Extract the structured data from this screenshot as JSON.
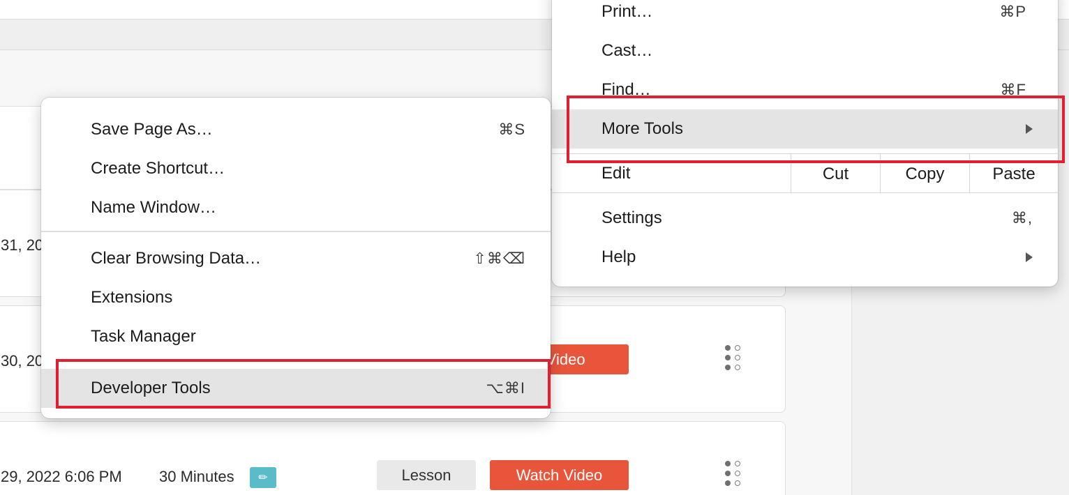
{
  "page": {
    "rows": [
      {
        "date": "31, 20",
        "duration": "",
        "lesson_label": "",
        "watch_label": ""
      },
      {
        "date": "30, 20",
        "duration": "",
        "lesson_label": "",
        "watch_label": "n Video"
      },
      {
        "date": "29, 2022 6:06 PM",
        "duration": "30 Minutes",
        "lesson_label": "Lesson",
        "watch_label": "Watch Video",
        "edit_icon": "pencil-icon"
      }
    ],
    "colors": {
      "watch_button": "#e9553b",
      "edit_badge": "#5bbcc9",
      "annotation": "#e0202f"
    }
  },
  "browser_menu": {
    "items": [
      {
        "label": "Print…",
        "shortcut": "⌘P"
      },
      {
        "label": "Cast…",
        "shortcut": ""
      },
      {
        "label": "Find…",
        "shortcut": "⌘F"
      },
      {
        "label": "More Tools",
        "shortcut": "",
        "submenu": true,
        "highlighted": true
      },
      {
        "label": "Settings",
        "shortcut": "⌘,"
      },
      {
        "label": "Help",
        "shortcut": "",
        "submenu": true
      }
    ],
    "edit": {
      "label": "Edit",
      "cut": "Cut",
      "copy": "Copy",
      "paste": "Paste"
    }
  },
  "more_tools_menu": {
    "items": [
      {
        "label": "Save Page As…",
        "shortcut": "⌘S"
      },
      {
        "label": "Create Shortcut…",
        "shortcut": ""
      },
      {
        "label": "Name Window…",
        "shortcut": ""
      },
      {
        "label": "Clear Browsing Data…",
        "shortcut": "⇧⌘⌫"
      },
      {
        "label": "Extensions",
        "shortcut": ""
      },
      {
        "label": "Task Manager",
        "shortcut": ""
      },
      {
        "label": "Developer Tools",
        "shortcut": "⌥⌘I",
        "highlighted": true
      }
    ]
  }
}
